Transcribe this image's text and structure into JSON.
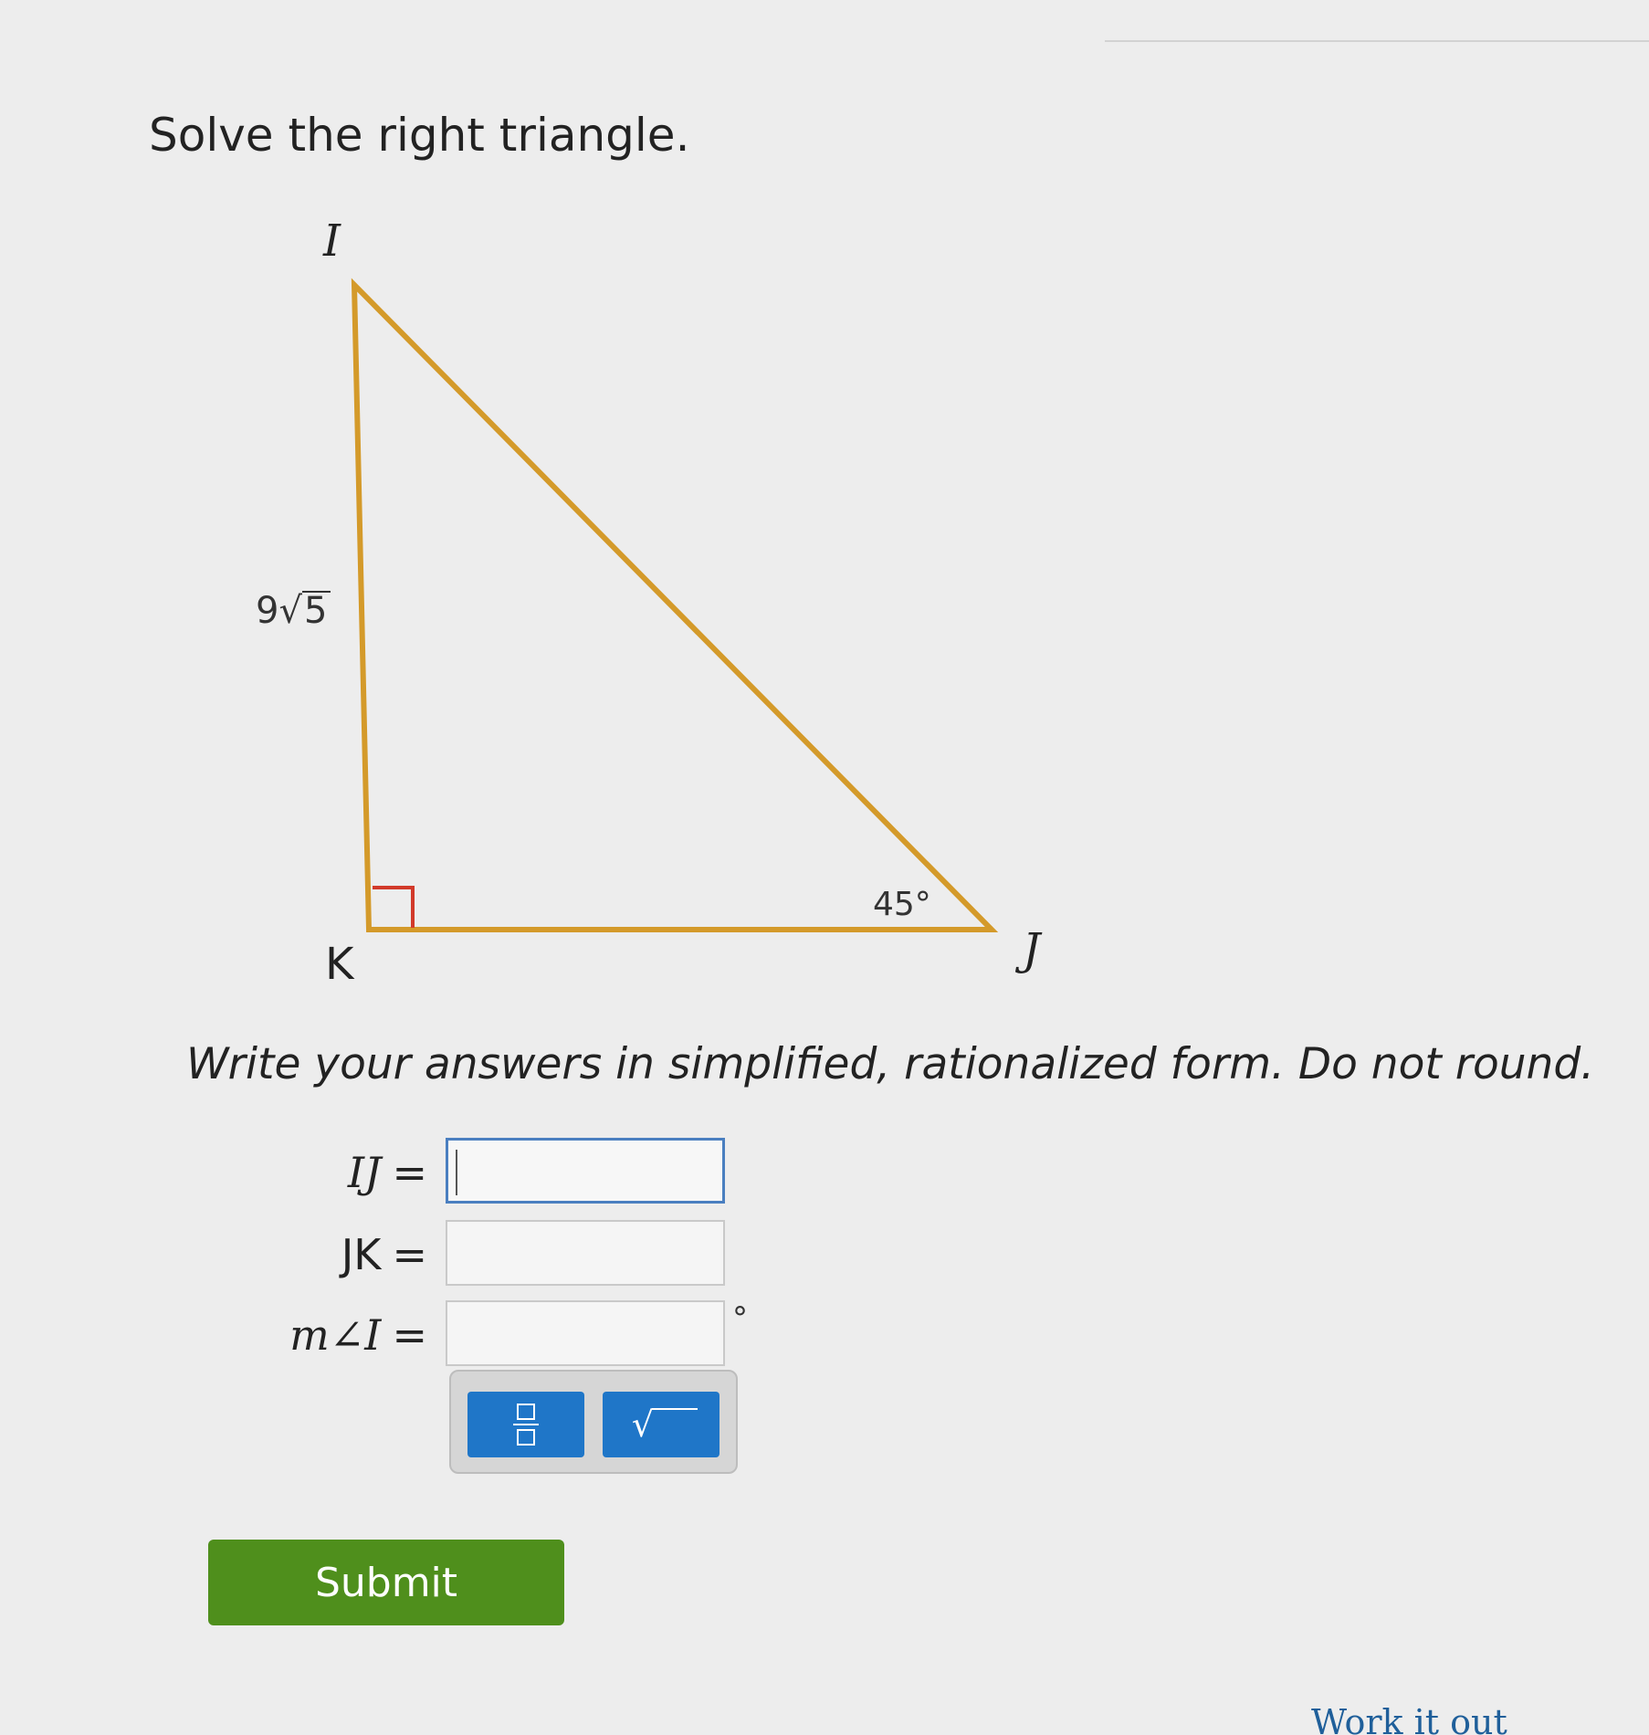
{
  "prompt": "Solve the right triangle.",
  "triangle": {
    "vertex_I": "I",
    "vertex_J": "J",
    "vertex_K": "K",
    "side_IK_coefficient": "9",
    "side_IK_radicand": "5",
    "angle_J": "45°",
    "colors": {
      "sides": "#d49a2a",
      "right_angle_marker": "#d23a2a"
    }
  },
  "instructions": "Write your answers in simplified, rationalized form. Do not round.",
  "answers": [
    {
      "label": "IJ",
      "value": ""
    },
    {
      "label": "JK",
      "value": ""
    },
    {
      "label": "m∠I",
      "value": "",
      "unit": "°"
    }
  ],
  "equals": "=",
  "palette": {
    "fraction_icon": "fraction-icon",
    "sqrt_icon": "square-root-icon"
  },
  "submit_label": "Submit",
  "work_it_out_label": "Work it out",
  "colors": {
    "accent_blue": "#1f76c8",
    "submit_green": "#4f8f1c"
  }
}
